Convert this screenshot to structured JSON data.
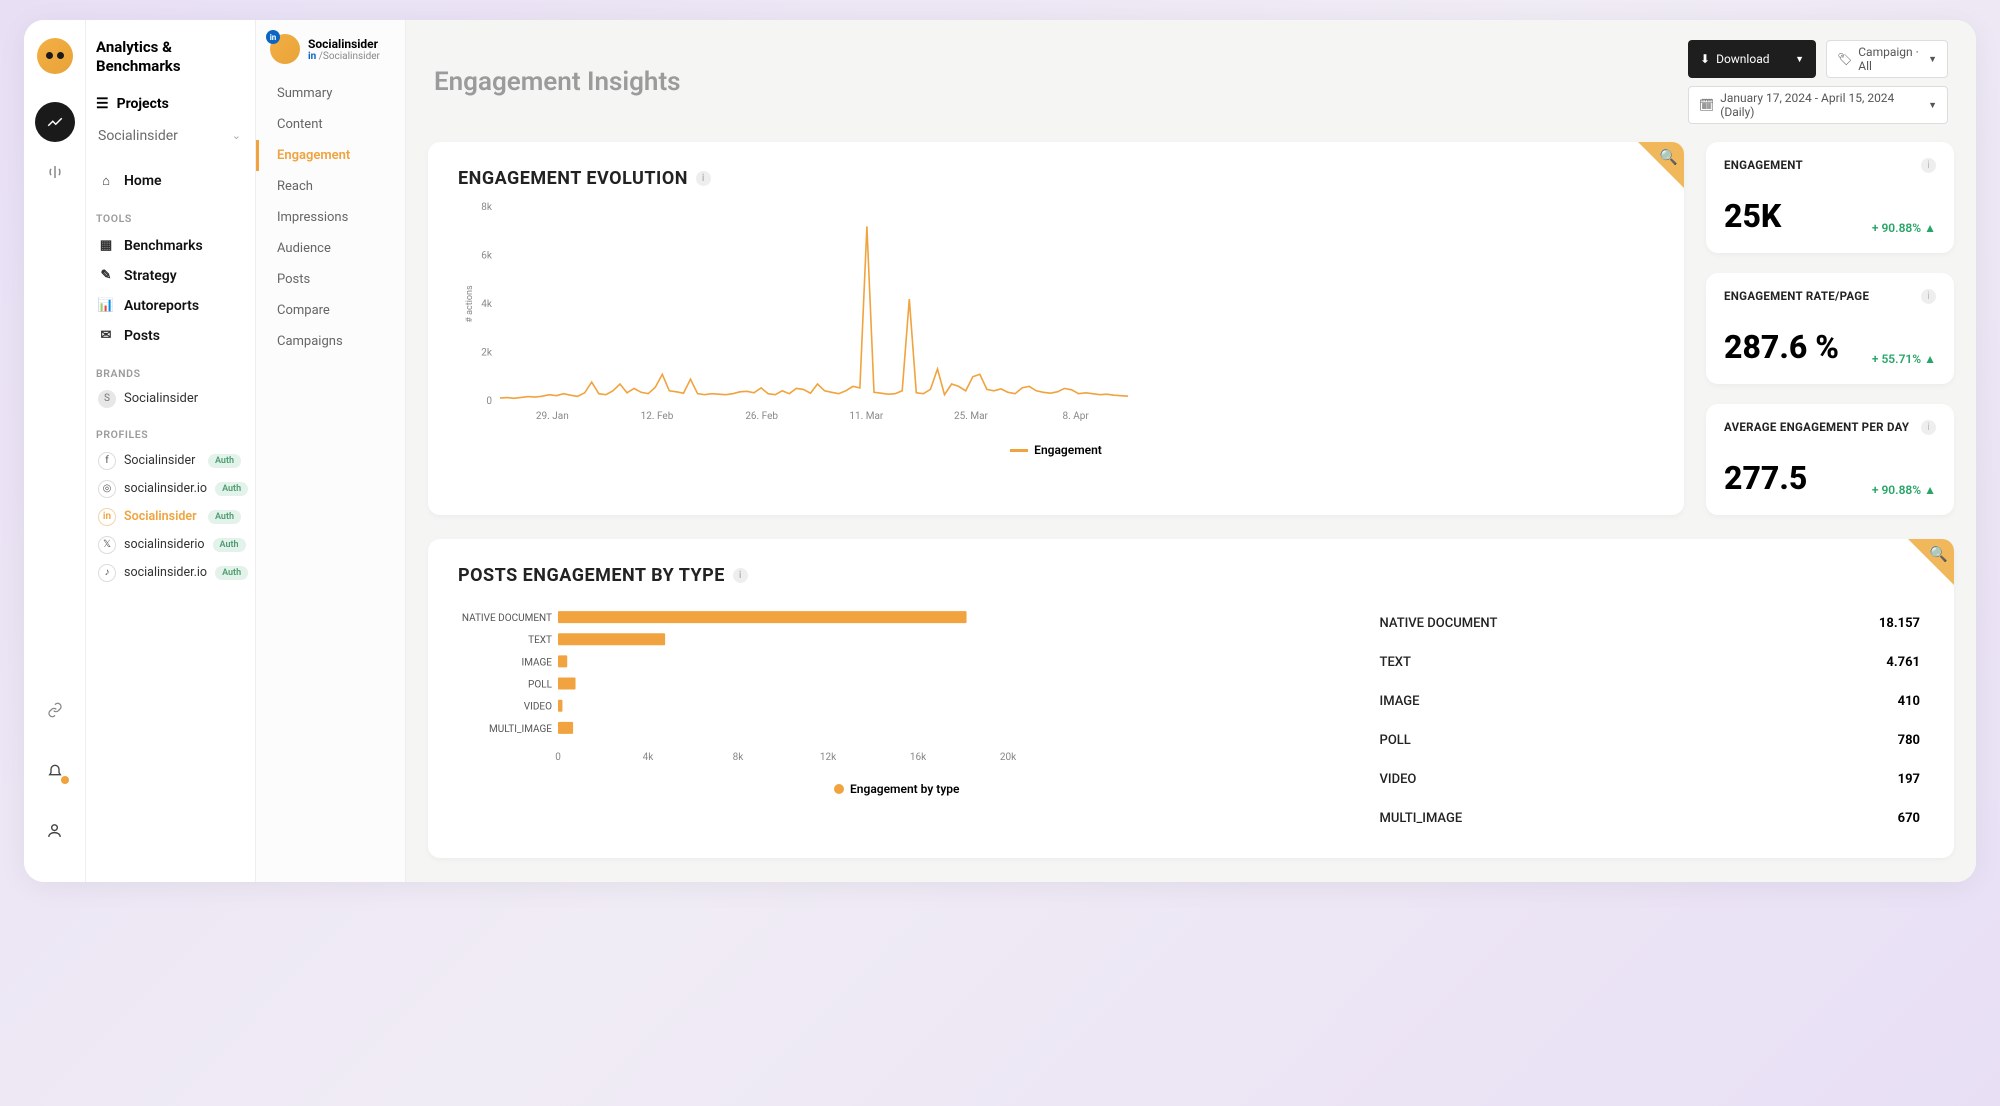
{
  "app_title": "Analytics & Benchmarks",
  "projects_label": "Projects",
  "project_selected": "Socialinsider",
  "nav": {
    "home": "Home",
    "tools_label": "TOOLS",
    "benchmarks": "Benchmarks",
    "strategy": "Strategy",
    "autoreports": "Autoreports",
    "posts": "Posts",
    "brands_label": "BRANDS",
    "profiles_label": "PROFILES"
  },
  "brand": {
    "name": "Socialinsider"
  },
  "profiles": [
    {
      "icon": "f",
      "name": "Socialinsider",
      "auth": "Auth",
      "active": false
    },
    {
      "icon": "ig",
      "name": "socialinsider.io",
      "auth": "Auth",
      "active": false
    },
    {
      "icon": "in",
      "name": "Socialinsider",
      "auth": "Auth",
      "active": true
    },
    {
      "icon": "tw",
      "name": "socialinsiderio",
      "auth": "Auth",
      "active": false
    },
    {
      "icon": "tk",
      "name": "socialinsider.io",
      "auth": "Auth",
      "active": false
    }
  ],
  "profile_header": {
    "name": "Socialinsider",
    "handle": "/Socialinsider",
    "network_badge": "in"
  },
  "subnav": [
    "Summary",
    "Content",
    "Engagement",
    "Reach",
    "Impressions",
    "Audience",
    "Posts",
    "Compare",
    "Campaigns"
  ],
  "subnav_active_index": 2,
  "page_title": "Engagement Insights",
  "controls": {
    "download": "Download",
    "campaign": "Campaign · All",
    "daterange": "January 17, 2024 - April 15, 2024 (Daily)"
  },
  "evolution": {
    "title": "ENGAGEMENT EVOLUTION",
    "legend": "Engagement",
    "ylabel": "# actions"
  },
  "kpis": [
    {
      "label": "ENGAGEMENT",
      "value": "25K",
      "delta": "+ 90.88%"
    },
    {
      "label": "ENGAGEMENT RATE/PAGE",
      "value": "287.6 %",
      "delta": "+ 55.71%"
    },
    {
      "label": "AVERAGE ENGAGEMENT PER DAY",
      "value": "277.5",
      "delta": "+ 90.88%"
    }
  ],
  "posts_by_type": {
    "title": "POSTS ENGAGEMENT BY TYPE",
    "legend": "Engagement by type",
    "rows": [
      {
        "name": "NATIVE DOCUMENT",
        "value": "18.157"
      },
      {
        "name": "TEXT",
        "value": "4.761"
      },
      {
        "name": "IMAGE",
        "value": "410"
      },
      {
        "name": "POLL",
        "value": "780"
      },
      {
        "name": "VIDEO",
        "value": "197"
      },
      {
        "name": "MULTI_IMAGE",
        "value": "670"
      }
    ]
  },
  "chart_data": [
    {
      "type": "line",
      "title": "ENGAGEMENT EVOLUTION",
      "ylabel": "# actions",
      "y_ticks": [
        0,
        2000,
        4000,
        6000,
        8000
      ],
      "x_tick_labels": [
        "29. Jan",
        "12. Feb",
        "26. Feb",
        "11. Mar",
        "25. Mar",
        "8. Apr"
      ],
      "series": [
        {
          "name": "Engagement",
          "color": "#f0a33e",
          "y": [
            120,
            140,
            110,
            150,
            180,
            160,
            200,
            260,
            220,
            300,
            240,
            190,
            340,
            780,
            300,
            260,
            420,
            700,
            340,
            520,
            360,
            300,
            560,
            1100,
            420,
            380,
            320,
            900,
            300,
            260,
            300,
            280,
            260,
            300,
            380,
            400,
            340,
            540,
            300,
            260,
            420,
            300,
            520,
            480,
            320,
            700,
            420,
            360,
            300,
            420,
            600,
            540,
            7200,
            360,
            320,
            280,
            300,
            420,
            4200,
            340,
            300,
            480,
            1320,
            260,
            700,
            600,
            420,
            1000,
            1100,
            480,
            420,
            500,
            360,
            300,
            540,
            600,
            420,
            360,
            320,
            380,
            520,
            460,
            300,
            340,
            300,
            260,
            280,
            240,
            220,
            200
          ]
        }
      ]
    },
    {
      "type": "bar",
      "orientation": "horizontal",
      "title": "POSTS ENGAGEMENT BY TYPE",
      "xlabel": "",
      "x_ticks": [
        0,
        4000,
        8000,
        12000,
        16000,
        20000
      ],
      "x_tick_labels": [
        "0",
        "4k",
        "8k",
        "12k",
        "16k",
        "20k"
      ],
      "categories": [
        "NATIVE DOCUMENT",
        "TEXT",
        "IMAGE",
        "POLL",
        "VIDEO",
        "MULTI_IMAGE"
      ],
      "values": [
        18157,
        4761,
        410,
        780,
        197,
        670
      ],
      "series": [
        {
          "name": "Engagement by type",
          "color": "#f0a33e"
        }
      ]
    }
  ]
}
